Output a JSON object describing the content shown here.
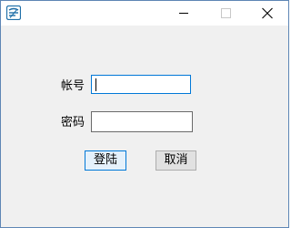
{
  "window": {
    "accent_border": "#5e86b5",
    "app_icon": "app-logo-icon",
    "controls": {
      "minimize": "minimize-icon",
      "maximize": "maximize-icon",
      "close": "close-icon"
    }
  },
  "form": {
    "account_label": "帐号",
    "account_value": "",
    "password_label": "密码",
    "password_value": "",
    "login_button": "登陆",
    "cancel_button": "取消"
  },
  "colors": {
    "focus_blue": "#0078d7",
    "panel_bg": "#f0f0f0"
  }
}
